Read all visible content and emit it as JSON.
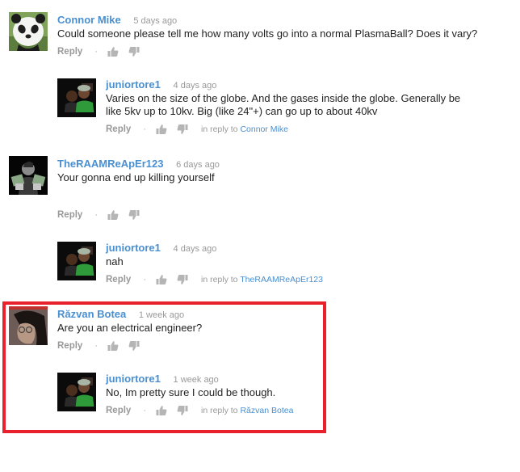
{
  "colors": {
    "link": "#4a8fd0",
    "highlight": "#e8212c",
    "meta": "#999999"
  },
  "labels": {
    "reply": "Reply",
    "in_reply_to": "in reply to",
    "like_icon": "thumbs-up-icon",
    "dislike_icon": "thumbs-down-icon"
  },
  "comments": [
    {
      "author": "Connor Mike",
      "time": "5 days ago",
      "text": "Could someone please tell me how many volts go into a normal PlasmaBall? Does it vary?",
      "avatar": "panda-avatar",
      "replies": [
        {
          "author": "juniortore1",
          "time": "4 days ago",
          "text": "Varies on the size of the globe. And the gases inside the globe. Generally be like 5kv up to 10kv. Big (like 24\"+) can go up to about 40kv",
          "avatar": "two-men-avatar",
          "in_reply_to": "Connor Mike"
        }
      ]
    },
    {
      "author": "TheRAAMReApEr123",
      "time": "6 days ago",
      "text": "Your gonna end up killing yourself",
      "avatar": "money-man-avatar",
      "replies": [
        {
          "author": "juniortore1",
          "time": "4 days ago",
          "text": "nah",
          "avatar": "two-men-avatar",
          "in_reply_to": "TheRAAMReApEr123"
        }
      ]
    },
    {
      "author": "Răzvan Botea",
      "time": "1 week ago",
      "text": "Are you an electrical engineer?",
      "avatar": "man-with-glasses-avatar",
      "highlighted": true,
      "replies": [
        {
          "author": "juniortore1",
          "time": "1 week ago",
          "text": "No, Im pretty sure I could be though.",
          "avatar": "two-men-avatar",
          "in_reply_to": "Răzvan Botea"
        }
      ]
    }
  ]
}
